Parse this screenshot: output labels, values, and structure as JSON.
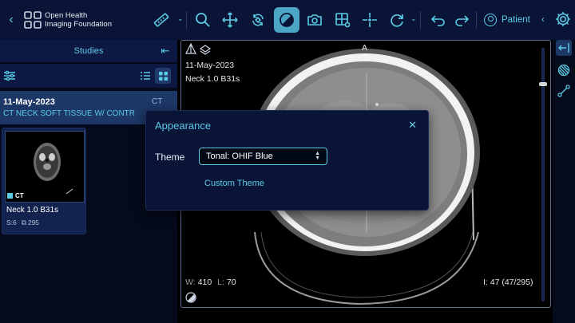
{
  "header": {
    "org_name_line1": "Open Health",
    "org_name_line2": "Imaging Foundation",
    "patient_label": "Patient"
  },
  "toolbar": {
    "tools": [
      "back-icon",
      "measure-ruler-icon",
      "zoom-icon",
      "pan-icon",
      "rotate-icon",
      "window-level-icon",
      "camera-icon",
      "layout-icon",
      "crosshairs-icon",
      "reset-icon",
      "undo-icon",
      "redo-icon"
    ],
    "active_tool": "window-level-icon",
    "accent_color": "#5acce6"
  },
  "left_panel": {
    "title": "Studies",
    "study": {
      "date": "11-May-2023",
      "modality": "CT",
      "description": "CT NECK SOFT TISSUE W/ CONTR"
    },
    "series": {
      "modality": "CT",
      "name": "Neck 1.0 B31s",
      "series_number": "S:6",
      "instance_count": "295"
    }
  },
  "viewport": {
    "orientation_top": "A",
    "date": "11-May-2023",
    "series_name": "Neck 1.0 B31s",
    "window_label": "W:",
    "window_value": "410",
    "level_label": "L:",
    "level_value": "70",
    "instance_info": "I: 47 (47/295)"
  },
  "modal": {
    "title": "Appearance",
    "theme_label": "Theme",
    "theme_value": "Tonal: OHIF Blue",
    "custom_link": "Custom Theme"
  }
}
